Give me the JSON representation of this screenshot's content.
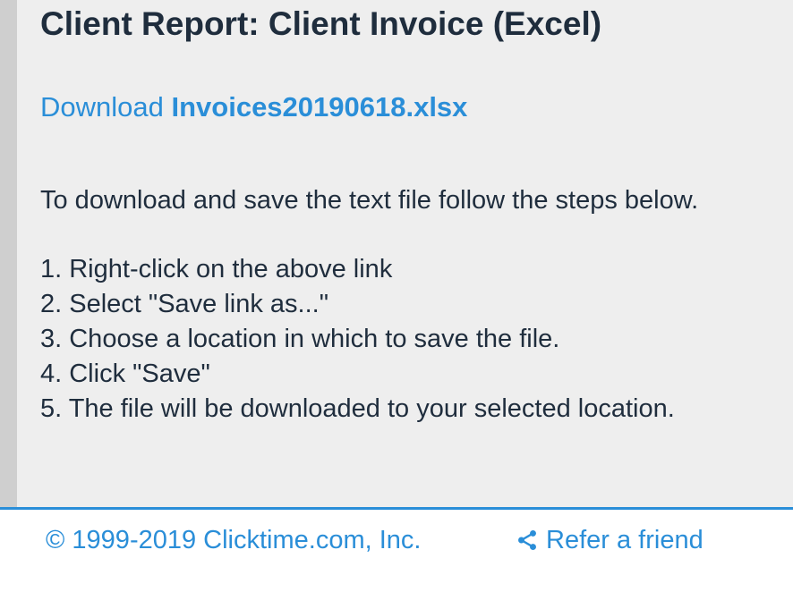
{
  "header": {
    "title": "Client Report: Client Invoice (Excel)"
  },
  "download": {
    "prefix": "Download ",
    "filename": "Invoices20190618.xlsx"
  },
  "instructions": {
    "intro": "To download and save the text file follow the steps below.",
    "steps": [
      "1. Right-click on the above link",
      "2. Select \"Save link as...\"",
      "3. Choose a location in which to save the file.",
      "4. Click \"Save\"",
      "5. The file will be downloaded to your selected location."
    ]
  },
  "footer": {
    "copyright": "© 1999-2019 Clicktime.com, Inc.",
    "refer_label": "Refer a friend",
    "refer_icon": "share-icon"
  },
  "colors": {
    "accent": "#2a8ed8",
    "text": "#1f2d3d",
    "background": "#eeeeee"
  }
}
